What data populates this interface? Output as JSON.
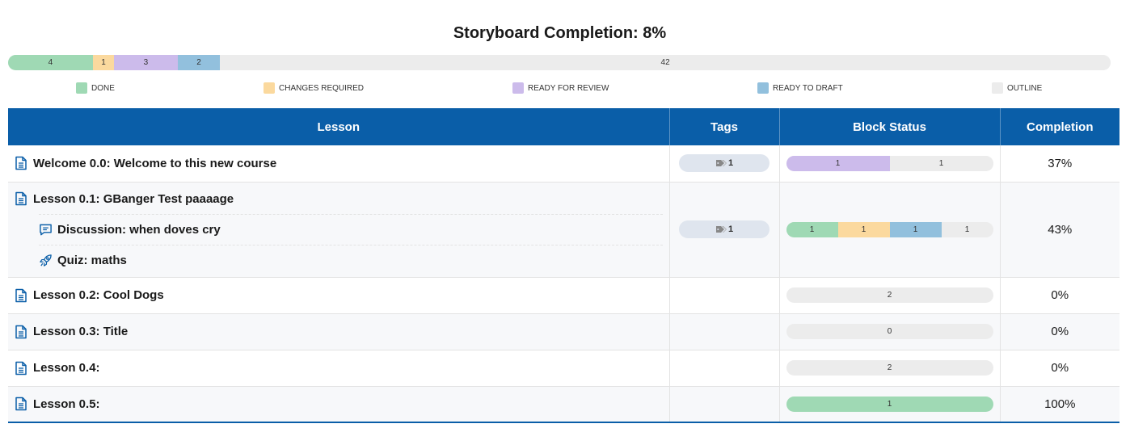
{
  "header": {
    "title": "Storyboard Completion: 8%"
  },
  "overall_bar": [
    {
      "status": "done",
      "label": "4",
      "fraction": 0.0769
    },
    {
      "status": "changes",
      "label": "1",
      "fraction": 0.0192
    },
    {
      "status": "review",
      "label": "3",
      "fraction": 0.0577
    },
    {
      "status": "draft",
      "label": "2",
      "fraction": 0.0385
    },
    {
      "status": "outline",
      "label": "42",
      "fraction": 0.8077
    }
  ],
  "legend": [
    {
      "status": "done",
      "label": "DONE"
    },
    {
      "status": "changes",
      "label": "CHANGES REQUIRED"
    },
    {
      "status": "review",
      "label": "READY FOR REVIEW"
    },
    {
      "status": "draft",
      "label": "READY TO DRAFT"
    },
    {
      "status": "outline",
      "label": "OUTLINE"
    }
  ],
  "colors": {
    "header_bg": "#0a5ea8",
    "done": "#9fd9b4",
    "changes": "#fbd99e",
    "review": "#ccbbeb",
    "draft": "#92c0dd",
    "outline": "#ececec"
  },
  "table": {
    "columns": [
      "Lesson",
      "Tags",
      "Block Status",
      "Completion"
    ],
    "rows": [
      {
        "lesson": "Welcome 0.0: Welcome to this new course",
        "icon": "document-icon",
        "children": [],
        "tags": "1",
        "status": [
          {
            "status": "review",
            "label": "1"
          },
          {
            "status": "outline",
            "label": "1"
          }
        ],
        "completion": "37%"
      },
      {
        "lesson": "Lesson 0.1: GBanger Test paaaage",
        "icon": "document-icon",
        "children": [
          {
            "label": "Discussion: when doves cry",
            "icon": "discussion-icon"
          },
          {
            "label": "Quiz: maths",
            "icon": "rocket-icon"
          }
        ],
        "tags": "1",
        "status": [
          {
            "status": "done",
            "label": "1"
          },
          {
            "status": "changes",
            "label": "1"
          },
          {
            "status": "draft",
            "label": "1"
          },
          {
            "status": "outline",
            "label": "1"
          }
        ],
        "completion": "43%"
      },
      {
        "lesson": "Lesson 0.2: Cool Dogs",
        "icon": "document-icon",
        "children": [],
        "tags": "",
        "status": [
          {
            "status": "outline",
            "label": "2"
          }
        ],
        "completion": "0%"
      },
      {
        "lesson": "Lesson 0.3: Title",
        "icon": "document-icon",
        "children": [],
        "tags": "",
        "status": [
          {
            "status": "outline",
            "label": "0"
          }
        ],
        "completion": "0%"
      },
      {
        "lesson": "Lesson 0.4:",
        "icon": "document-icon",
        "children": [],
        "tags": "",
        "status": [
          {
            "status": "outline",
            "label": "2"
          }
        ],
        "completion": "0%"
      },
      {
        "lesson": "Lesson 0.5:",
        "icon": "document-icon",
        "children": [],
        "tags": "",
        "status": [
          {
            "status": "done",
            "label": "1"
          }
        ],
        "completion": "100%"
      }
    ]
  }
}
